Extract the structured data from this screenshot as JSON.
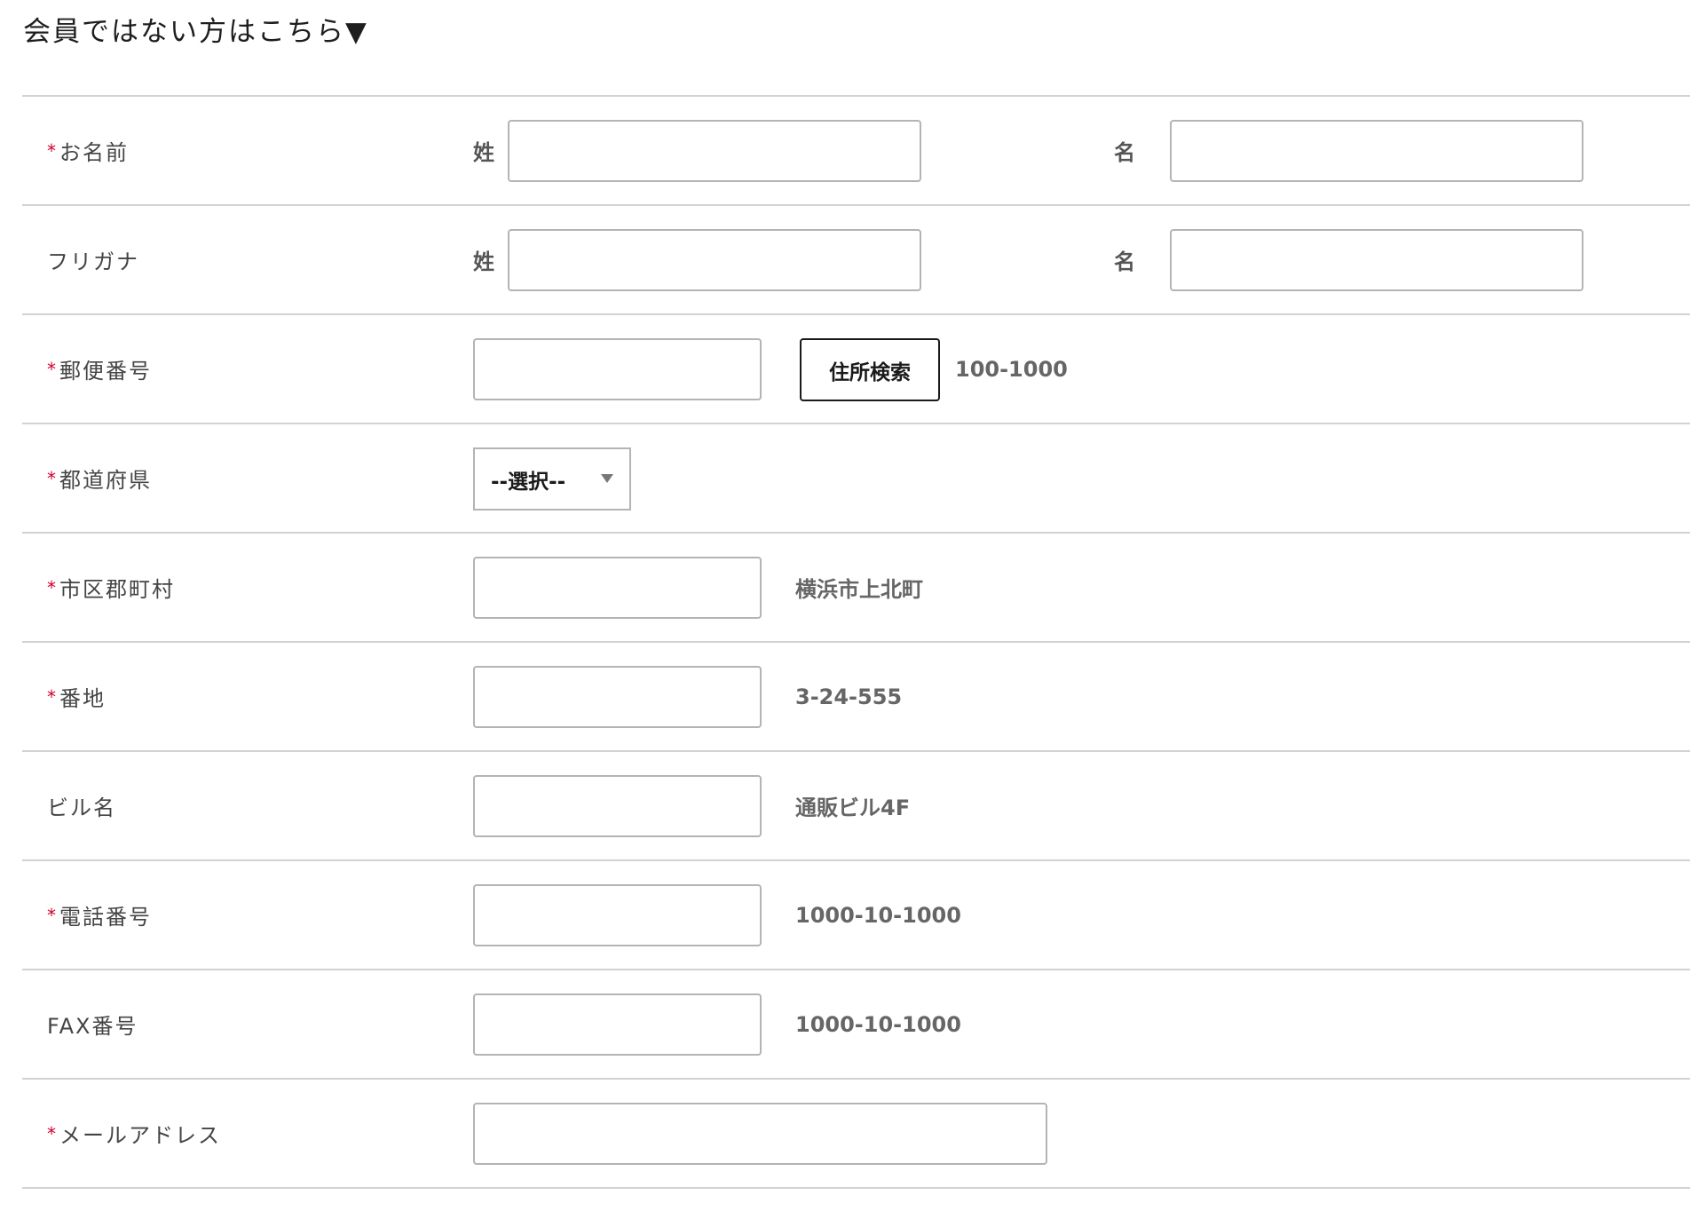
{
  "section_title": "会員ではない方はこちら▼",
  "required_mark": "*",
  "rows": {
    "name": {
      "label": "お名前",
      "sei_label": "姓",
      "mei_label": "名"
    },
    "kana": {
      "label": "フリガナ",
      "sei_label": "姓",
      "mei_label": "名"
    },
    "postal": {
      "label": "郵便番号",
      "button_label": "住所検索",
      "hint": "100-1000"
    },
    "prefecture": {
      "label": "都道府県",
      "selected": "--選択--"
    },
    "city": {
      "label": "市区郡町村",
      "hint": "横浜市上北町"
    },
    "street": {
      "label": "番地",
      "hint": "3-24-555"
    },
    "building": {
      "label": "ビル名",
      "hint": "通販ビル4F"
    },
    "phone": {
      "label": "電話番号",
      "hint": "1000-10-1000"
    },
    "fax": {
      "label": "FAX番号",
      "hint": "1000-10-1000"
    },
    "email": {
      "label": "メールアドレス"
    }
  },
  "colors": {
    "required": "#d0002f",
    "border": "#d2d2d2",
    "input_border": "#b4b4b4",
    "hint_text": "#666666"
  }
}
